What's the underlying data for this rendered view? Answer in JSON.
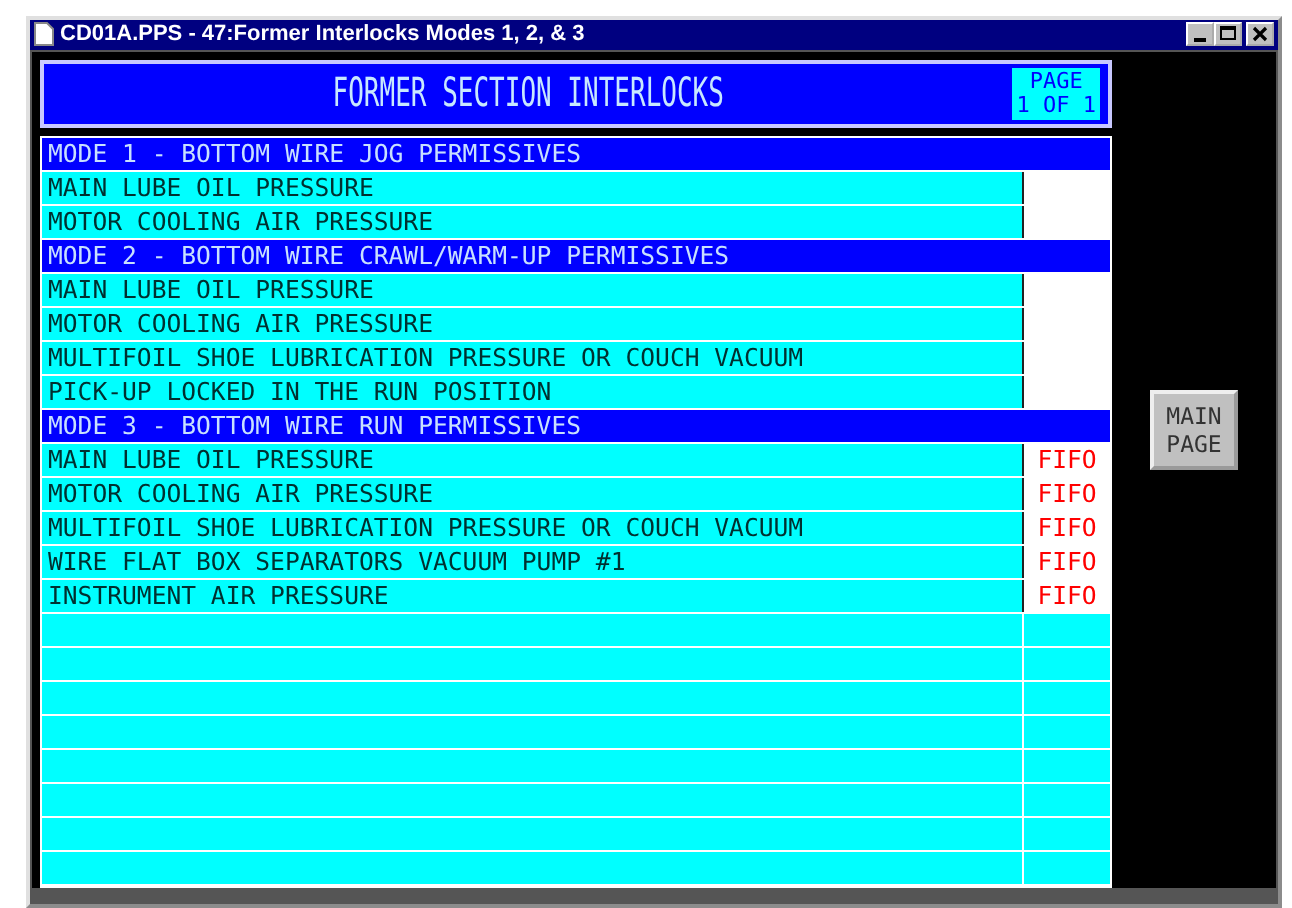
{
  "window": {
    "title": "CD01A.PPS - 47:Former Interlocks Modes 1, 2, & 3"
  },
  "header": {
    "title": "FORMER SECTION INTERLOCKS",
    "page_line_1": "PAGE",
    "page_line_2": "1 OF 1"
  },
  "sections": [
    {
      "title": "MODE 1 - BOTTOM WIRE JOG PERMISSIVES",
      "items": [
        {
          "label": "MAIN LUBE OIL PRESSURE"
        },
        {
          "label": "MOTOR COOLING AIR PRESSURE"
        }
      ]
    },
    {
      "title": "MODE 2 - BOTTOM WIRE CRAWL/WARM-UP PERMISSIVES",
      "items": [
        {
          "label": "MAIN LUBE OIL PRESSURE"
        },
        {
          "label": "MOTOR COOLING AIR PRESSURE"
        },
        {
          "label": "MULTIFOIL SHOE LUBRICATION PRESSURE OR COUCH VACUUM"
        },
        {
          "label": "PICK-UP LOCKED IN THE RUN POSITION"
        }
      ]
    },
    {
      "title": "MODE 3 - BOTTOM WIRE RUN PERMISSIVES",
      "items": [
        {
          "label": "MAIN LUBE OIL PRESSURE",
          "status": "FIFO"
        },
        {
          "label": "MOTOR COOLING AIR PRESSURE",
          "status": "FIFO"
        },
        {
          "label": "MULTIFOIL SHOE LUBRICATION PRESSURE OR COUCH VACUUM",
          "status": "FIFO"
        },
        {
          "label": "WIRE FLAT BOX SEPARATORS VACUUM PUMP #1",
          "status": "FIFO"
        },
        {
          "label": "INSTRUMENT AIR PRESSURE",
          "status": "FIFO"
        }
      ]
    }
  ],
  "main_page_button": {
    "line_1": "MAIN",
    "line_2": "PAGE"
  }
}
